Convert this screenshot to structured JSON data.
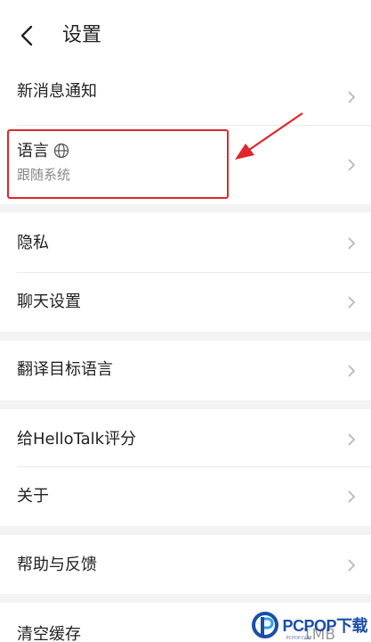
{
  "header": {
    "title": "设置"
  },
  "rows": {
    "notifications": "新消息通知",
    "language_label": "语言",
    "language_value": "跟随系统",
    "privacy": "隐私",
    "chat_settings": "聊天设置",
    "translate_target": "翻译目标语言",
    "rate_app": "给HelloTalk评分",
    "about": "关于",
    "help": "帮助与反馈",
    "clear_cache": "清空缓存",
    "cache_size": "1MB"
  },
  "watermark": {
    "brand": "PCPOP下载",
    "sub": "PCPOP.COM"
  },
  "colors": {
    "highlight": "#e0262b",
    "watermark": "#1a4ea8"
  }
}
